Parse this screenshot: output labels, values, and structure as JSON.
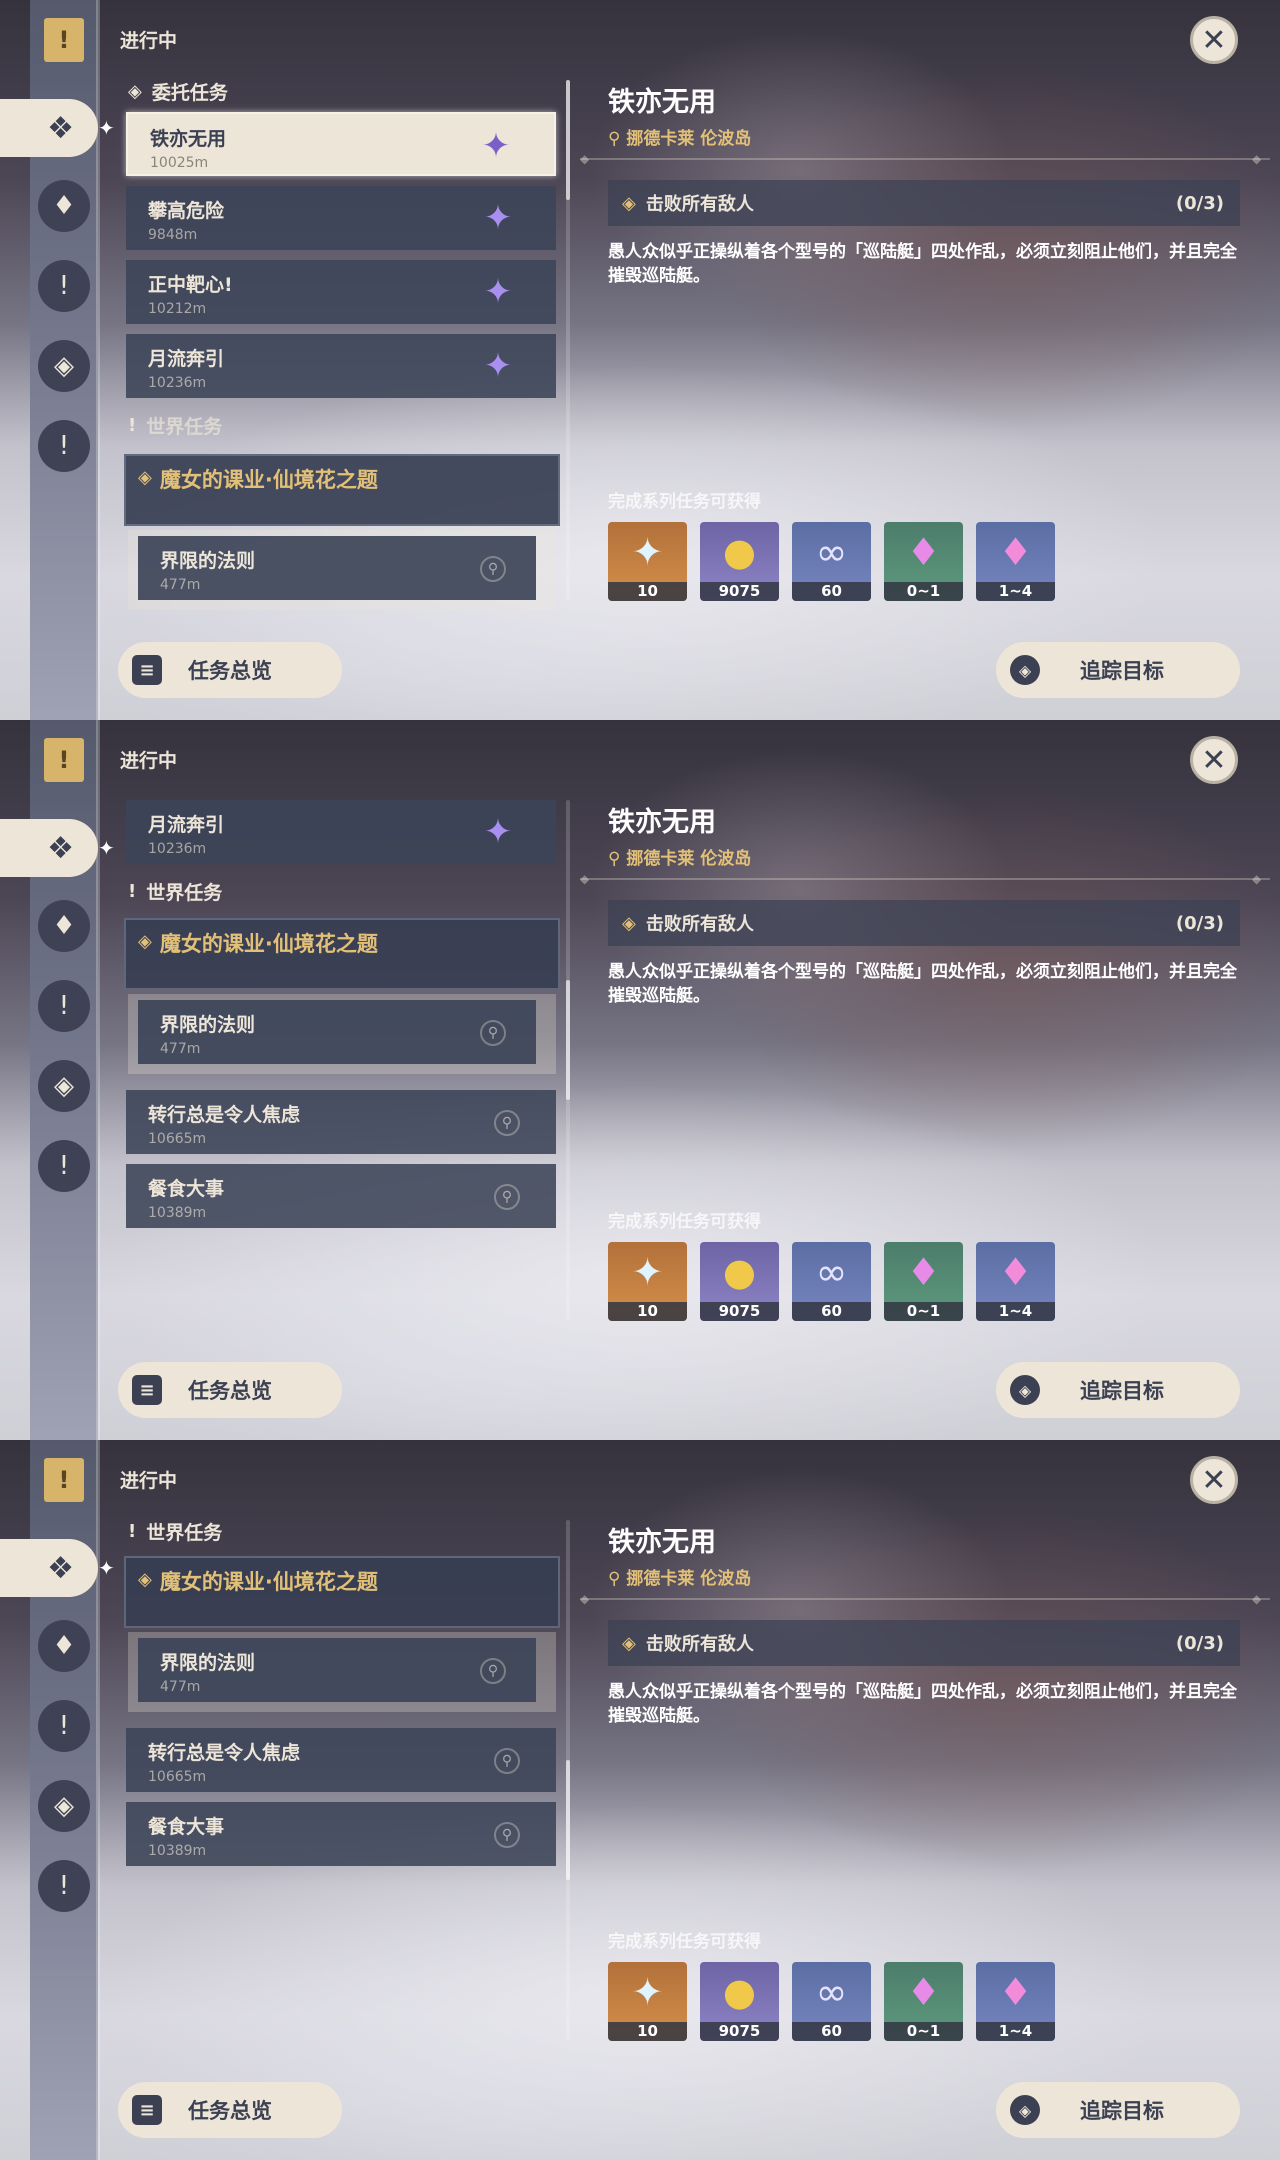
{
  "header_label": "进行中",
  "section_commission": "委托任务",
  "section_world": "世界任务",
  "commissions": [
    {
      "name": "铁亦无用",
      "distance": "10025m"
    },
    {
      "name": "攀高危险",
      "distance": "9848m"
    },
    {
      "name": "正中靶心!",
      "distance": "10212m"
    },
    {
      "name": "月流奔引",
      "distance": "10236m"
    }
  ],
  "world_quest": {
    "name": "魔女的课业·仙境花之题"
  },
  "world_subquests": [
    {
      "name": "界限的法则",
      "distance": "477m"
    }
  ],
  "other_quests": [
    {
      "name": "转行总是令人焦虑",
      "distance": "10665m"
    },
    {
      "name": "餐食大事",
      "distance": "10389m"
    }
  ],
  "detail": {
    "title": "铁亦无用",
    "location": "挪德卡莱 伦波岛",
    "objective": "击败所有敌人",
    "objective_count": "(0/3)",
    "description": "愚人众似乎正操纵着各个型号的「巡陆艇」四处作乱，必须立刻阻止他们，并且完全摧毁巡陆艇。",
    "reward_label": "完成系列任务可获得",
    "rewards": [
      {
        "icon": "primogem-icon",
        "count": "10"
      },
      {
        "icon": "mora-icon",
        "count": "9075"
      },
      {
        "icon": "companionship-exp-icon",
        "count": "60"
      },
      {
        "icon": "crystal-icon",
        "count": "0~1"
      },
      {
        "icon": "crystal-cluster-icon",
        "count": "1~4"
      }
    ]
  },
  "buttons": {
    "overview": "任务总览",
    "track": "追踪目标"
  },
  "colors": {
    "accent_gold": "#e2c078",
    "panel_cream": "#ece5d8",
    "dark_slate": "#3b4052",
    "commission_purple": "#a98ff0"
  }
}
